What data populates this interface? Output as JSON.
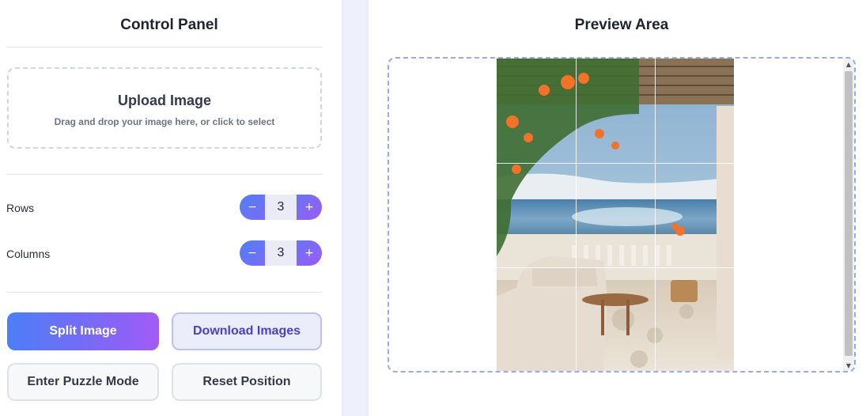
{
  "control_panel": {
    "title": "Control Panel",
    "upload": {
      "title": "Upload Image",
      "hint": "Drag and drop your image here, or click to select"
    },
    "rows": {
      "label": "Rows",
      "value": "3",
      "minus": "−",
      "plus": "+"
    },
    "columns": {
      "label": "Columns",
      "value": "3",
      "minus": "−",
      "plus": "+"
    },
    "buttons": {
      "split": "Split Image",
      "download": "Download Images",
      "puzzle": "Enter Puzzle Mode",
      "reset": "Reset Position"
    }
  },
  "preview": {
    "title": "Preview Area",
    "grid": {
      "rows": 3,
      "columns": 3
    }
  },
  "colors": {
    "background": "#eef0fb",
    "accent_blue": "#4c7ef7",
    "accent_purple": "#a35bf5",
    "download_text": "#4a3fd0",
    "preview_border": "#9aa8f0"
  },
  "icons": {
    "scroll_up": "triangle-up-icon",
    "scroll_down": "triangle-down-icon"
  }
}
